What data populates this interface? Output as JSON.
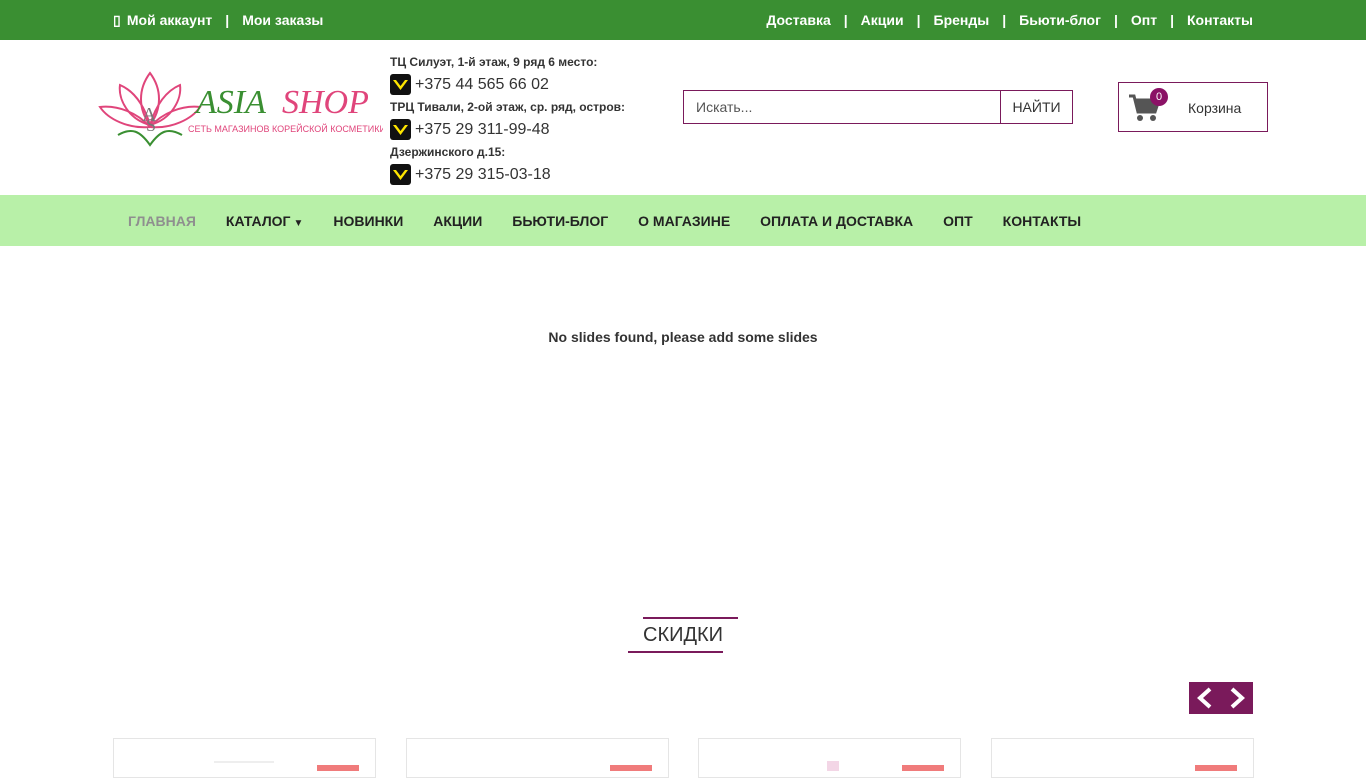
{
  "topbar": {
    "account": "Мой аккаунт",
    "orders": "Мои заказы",
    "links": [
      "Доставка",
      "Акции",
      "Бренды",
      "Бьюти-блог",
      "Опт",
      "Контакты"
    ],
    "separator": "|"
  },
  "logo": {
    "brand": "ASIASHOP",
    "tagline": "СЕТЬ МАГАЗИНОВ КОРЕЙСКОЙ КОСМЕТИКИ"
  },
  "contacts": [
    {
      "address": "ТЦ Силуэт, 1-й этаж, 9 ряд 6 место:",
      "phone": "+375 44 565 66 02",
      "icon": "viber-icon"
    },
    {
      "address": "ТРЦ Тивали, 2-ой этаж, ср. ряд, остров:",
      "phone": "+375 29 311-99-48",
      "icon": "viber-icon"
    },
    {
      "address": "Дзержинского д.15:",
      "phone": "+375 29 315-03-18",
      "icon": "viber-icon"
    }
  ],
  "search": {
    "placeholder": "Искать...",
    "button": "НАЙТИ"
  },
  "cart": {
    "count": "0",
    "label": "Корзина"
  },
  "nav": {
    "items": [
      "Главная",
      "Каталог",
      "Новинки",
      "Акции",
      "Бьюти-блог",
      "О магазине",
      "Оплата и доставка",
      "Опт",
      "Контакты"
    ],
    "active": "Главная"
  },
  "slider": {
    "message": "No slides found, please add some slides"
  },
  "discounts": {
    "title": "СКИДКИ",
    "card_count": 4
  },
  "colors": {
    "topbar": "#3a8f32",
    "nav": "#b8f0a8",
    "accent": "#7a1a5b",
    "badge": "#8b1266",
    "sale": "#f07b7b"
  }
}
